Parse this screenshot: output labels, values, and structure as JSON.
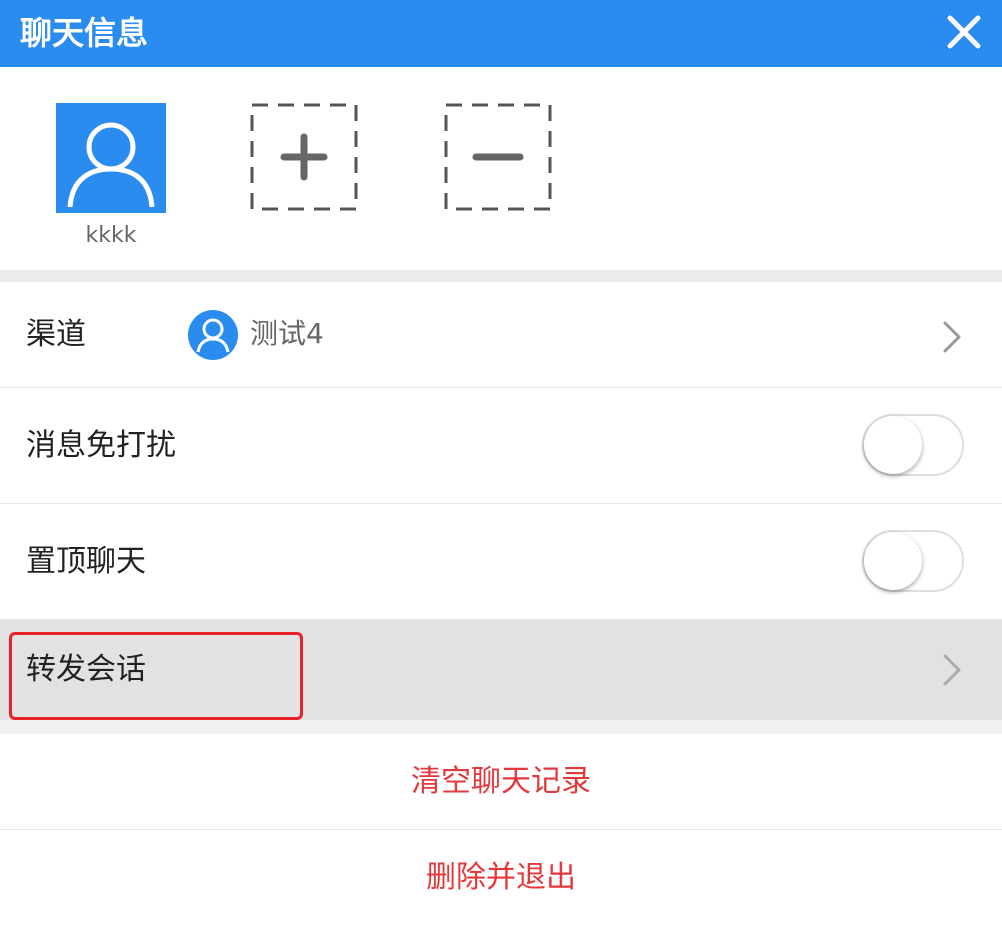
{
  "header": {
    "title": "聊天信息"
  },
  "members": [
    {
      "name": "kkkk"
    }
  ],
  "settings": {
    "channel": {
      "label": "渠道",
      "value": "测试4"
    },
    "mute": {
      "label": "消息免打扰",
      "enabled": false
    },
    "pin": {
      "label": "置顶聊天",
      "enabled": false
    },
    "forward": {
      "label": "转发会话"
    }
  },
  "actions": {
    "clear": "清空聊天记录",
    "delete_exit": "删除并退出"
  },
  "colors": {
    "header_bg": "#2b8cf0",
    "danger_text": "#e4393c",
    "highlight_border": "#e8222a"
  }
}
